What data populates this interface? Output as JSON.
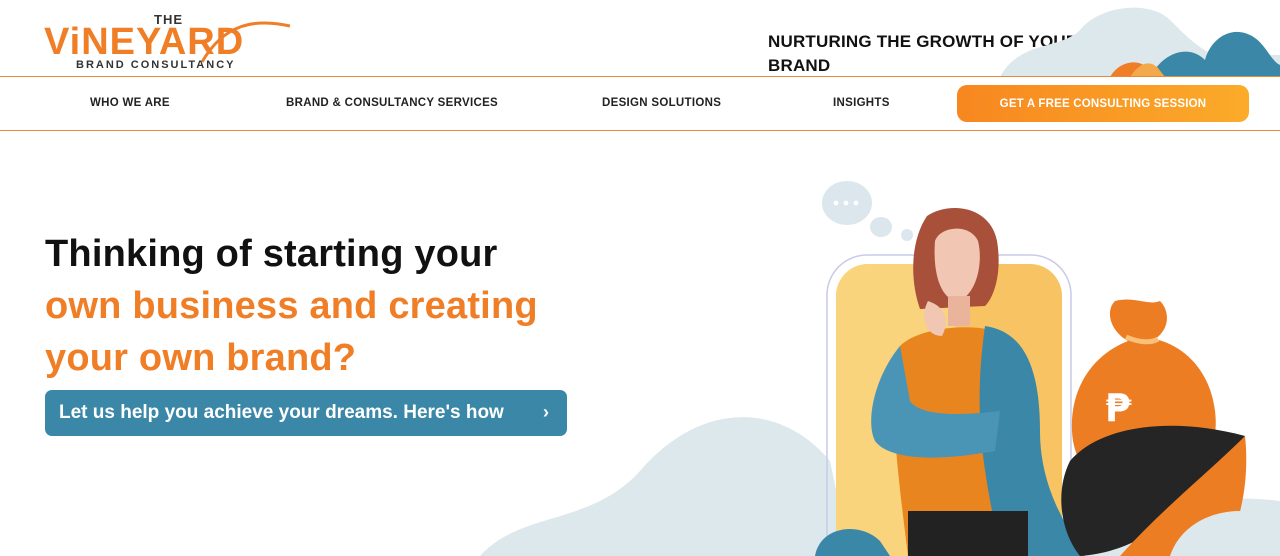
{
  "header": {
    "logo": {
      "the": "THE",
      "wordmark": "ViNEYARD",
      "subtitle": "BRAND CONSULTANCY"
    },
    "tagline_line1": "NURTURING THE GROWTH OF YOUR",
    "tagline_line2": "BRAND"
  },
  "nav": {
    "items": [
      {
        "label": "WHO WE ARE"
      },
      {
        "label": "BRAND & CONSULTANCY SERVICES"
      },
      {
        "label": "DESIGN SOLUTIONS"
      },
      {
        "label": "INSIGHTS"
      }
    ],
    "cta_label": "GET A FREE CONSULTING SESSION"
  },
  "hero": {
    "headline_line1": "Thinking of starting your",
    "headline_line2": "own business and creating",
    "headline_line3": "your own brand?",
    "button_label": "Let us help you achieve your dreams. Here's how",
    "button_chevron": "›",
    "thought_bubble_text": "• • •",
    "money_symbol": "₱"
  },
  "colors": {
    "brand_orange": "#f07e26",
    "cta_gradient_start": "#f7871f",
    "cta_gradient_end": "#fbab2a",
    "hero_button_blue": "#3b87a8",
    "border_orange": "#e58a3c"
  },
  "icons": {
    "thought_bubble": "thought-bubble-icon",
    "money_bag": "money-bag-icon",
    "chevron": "chevron-right-icon"
  }
}
